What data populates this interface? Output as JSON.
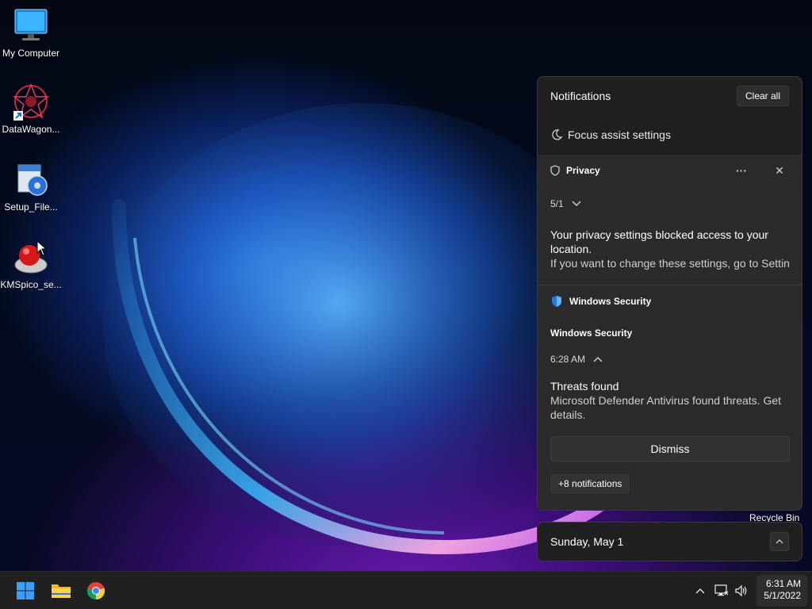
{
  "desktop": {
    "icons": [
      {
        "label": "My Computer",
        "icon": "monitor-icon"
      },
      {
        "label": "DataWagon...",
        "icon": "datawagon-icon"
      },
      {
        "label": "Setup_File...",
        "icon": "setup-installer-icon"
      },
      {
        "label": "KMSpico_se...",
        "icon": "kmspico-icon"
      }
    ],
    "recycle_bin_label": "Recycle Bin"
  },
  "notifications": {
    "title": "Notifications",
    "clear_all": "Clear all",
    "focus_assist": "Focus assist settings",
    "privacy": {
      "app": "Privacy",
      "more": "···",
      "close": "✕",
      "time": "5/1",
      "title": "Your privacy settings blocked access to your location.",
      "body": "If you want to change these settings, go to Settin"
    },
    "security": {
      "app": "Windows Security",
      "subheader": "Windows Security",
      "time": "6:28 AM",
      "title": "Threats found",
      "body": "Microsoft Defender Antivirus found threats. Get details.",
      "dismiss": "Dismiss",
      "more_count": "+8 notifications"
    }
  },
  "calendar": {
    "date": "Sunday, May 1"
  },
  "taskbar": {
    "apps": [
      "start-icon",
      "file-explorer-icon",
      "chrome-icon"
    ],
    "tray": [
      "show-hidden-icons-chevron",
      "network-icon",
      "volume-icon"
    ],
    "time": "6:31 AM",
    "date": "5/1/2022"
  },
  "colors": {
    "panel_bg": "#202020",
    "card_bg": "#2b2b2b",
    "taskbar_bg": "#202020",
    "accent": "#0a84ff"
  }
}
